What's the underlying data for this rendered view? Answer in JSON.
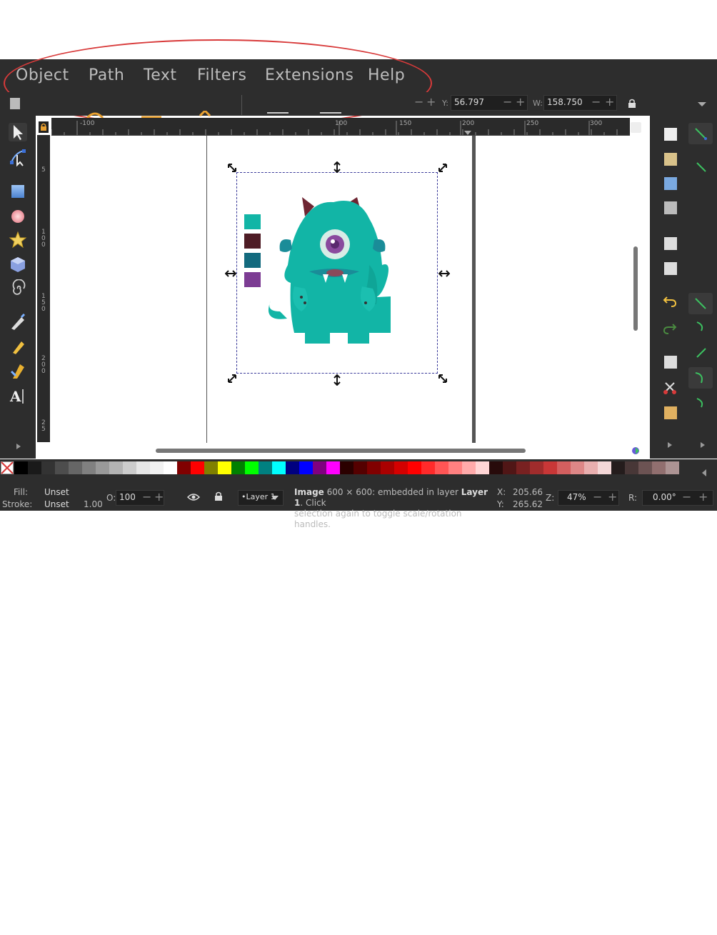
{
  "menu": {
    "items": [
      "Object",
      "Path",
      "Text",
      "Filters",
      "Extensions",
      "Help"
    ]
  },
  "toolbar": {
    "y_label": "Y:",
    "y_value": "56.797",
    "w_label": "W:",
    "w_value": "158.750"
  },
  "ruler_top": {
    "ticks": [
      "-100",
      "100",
      "150",
      "200",
      "250",
      "300"
    ]
  },
  "ruler_left": {
    "ticks": [
      "5",
      "1",
      "0",
      "0",
      "1",
      "5",
      "0",
      "2",
      "0",
      "0",
      "2",
      "5"
    ]
  },
  "palette": {
    "colors": [
      "#000000",
      "#1a1a1a",
      "#333333",
      "#4d4d4d",
      "#666666",
      "#808080",
      "#999999",
      "#b3b3b3",
      "#cccccc",
      "#e6e6e6",
      "#f2f2f2",
      "#ffffff",
      "#800000",
      "#ff0000",
      "#808000",
      "#ffff00",
      "#008000",
      "#00ff00",
      "#008080",
      "#00ffff",
      "#000080",
      "#0000ff",
      "#800080",
      "#ff00ff",
      "#2b0000",
      "#550000",
      "#800000",
      "#aa0000",
      "#d40000",
      "#ff0000",
      "#ff2a2a",
      "#ff5555",
      "#ff8080",
      "#ffaaaa",
      "#ffd5d5",
      "#280b0b",
      "#501616",
      "#782121",
      "#a02c2c",
      "#c83737",
      "#d35f5f",
      "#de8787",
      "#e9afaf",
      "#f4d7d7",
      "#241c1c",
      "#483737",
      "#6c5353",
      "#916f6f",
      "#ac9393"
    ]
  },
  "swatches": [
    "#12b5a6",
    "#4e1c25",
    "#136a7e",
    "#7c3c93"
  ],
  "statusbar": {
    "fill_label": "Fill:",
    "fill_value": "Unset",
    "stroke_label": "Stroke:",
    "stroke_value": "Unset",
    "stroke_width": "1.00",
    "opacity_label": "O:",
    "opacity_value": "100",
    "layer_name": "•Layer 1",
    "msg_prefix": "Image",
    "msg_dims": " 600 × 600: embedded in layer ",
    "msg_layer": "Layer 1",
    "msg_end": ". Click",
    "msg_line2": "selection again to toggle scale/rotation handles.",
    "x_label": "X:",
    "x_value": "205.66",
    "y_label": "Y:",
    "y_value": "265.62",
    "zoom_label": "Z:",
    "zoom_value": "47%",
    "rot_label": "R:",
    "rot_value": "0.00°"
  },
  "icons": {
    "lock": "lock-icon",
    "eye": "eye-icon"
  }
}
